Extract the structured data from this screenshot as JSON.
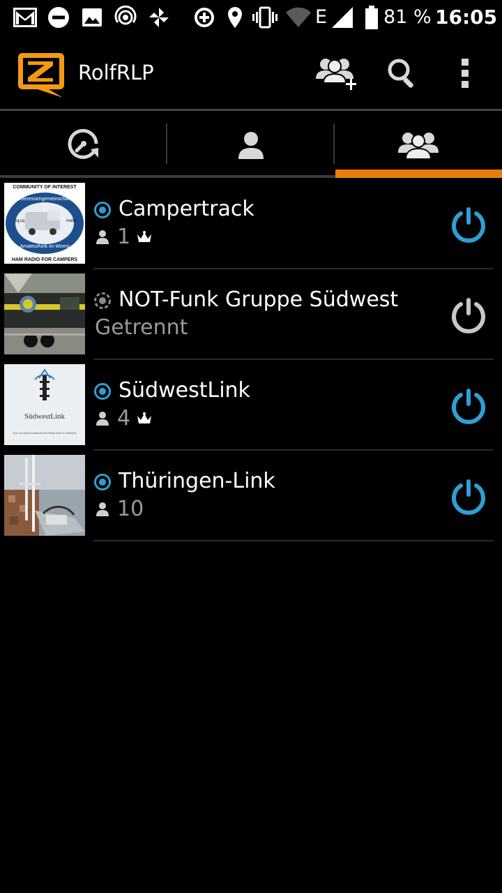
{
  "status_bar": {
    "battery_percent": "81 %",
    "network_label": "E",
    "time": "16:05",
    "icons": [
      "gmail-icon",
      "do-not-disturb-icon",
      "image-icon",
      "hotspot-icon",
      "pinwheel-icon",
      "data-saver-icon",
      "location-icon",
      "vibrate-icon",
      "wifi-icon",
      "signal-icon",
      "battery-icon"
    ]
  },
  "app_bar": {
    "title": "RolfRLP",
    "logo": "zello-logo",
    "actions": [
      "add-channel-icon",
      "search-icon",
      "overflow-menu-icon"
    ]
  },
  "tabs": [
    {
      "icon": "recents-icon",
      "selected": false
    },
    {
      "icon": "contact-icon",
      "selected": false
    },
    {
      "icon": "channels-icon",
      "selected": true
    }
  ],
  "colors": {
    "accent": "#e87f0c",
    "online_blue": "#2f9fd3",
    "offline_gray": "#8a8a8a",
    "subtext": "#9a9a9a",
    "background": "#000000"
  },
  "channels": [
    {
      "name": "Campertrack",
      "status": "connected",
      "user_count": "1",
      "has_crown": true,
      "subtitle": "",
      "thumb": {
        "top_text": "COMMUNITY OF INTEREST",
        "ring_text": "Interessengemeinschaft",
        "left": "cq,cq",
        "right": "mobil",
        "bottom_ring": "Amateurfunk im Womo",
        "bottom_text": "HAM RADIO FOR CAMPERS"
      }
    },
    {
      "name": "NOT-Funk Gruppe Südwest",
      "status": "disconnected",
      "user_count": "",
      "has_crown": false,
      "subtitle": "Getrennt"
    },
    {
      "name": "SüdwestLink",
      "status": "connected",
      "user_count": "4",
      "has_crown": true,
      "subtitle": "",
      "thumb": {
        "title": "SüdwestLink",
        "caption": "Das vernetzte Amateurfunk-Relais-Netz in Südwest"
      }
    },
    {
      "name": "Thüringen-Link",
      "status": "connected",
      "user_count": "10",
      "has_crown": false,
      "subtitle": ""
    }
  ]
}
